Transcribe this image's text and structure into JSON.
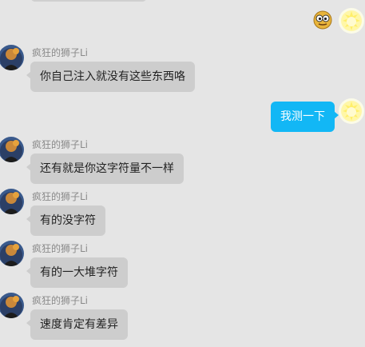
{
  "contact": {
    "name": "疯狂的狮子Li"
  },
  "self": {
    "emoji_message": "emoji-face-icon"
  },
  "messages": [
    {
      "side": "out",
      "type": "emoji",
      "icon": "emoji-face-icon"
    },
    {
      "side": "in",
      "sender": "疯狂的狮子Li",
      "text": "你自己注入就没有这些东西咯"
    },
    {
      "side": "out",
      "type": "text",
      "text": "我测一下"
    },
    {
      "side": "in",
      "sender": "疯狂的狮子Li",
      "text": "还有就是你这字符量不一样"
    },
    {
      "side": "in",
      "sender": "疯狂的狮子Li",
      "text": "有的没字符"
    },
    {
      "side": "in",
      "sender": "疯狂的狮子Li",
      "text": "有的一大堆字符"
    },
    {
      "side": "in",
      "sender": "疯狂的狮子Li",
      "text": "速度肯定有差异"
    }
  ],
  "colors": {
    "background": "#e5e5e5",
    "incoming_bubble": "#cdcdcd",
    "outgoing_bubble": "#12b7f5",
    "sender_name": "#8a8a8a"
  }
}
